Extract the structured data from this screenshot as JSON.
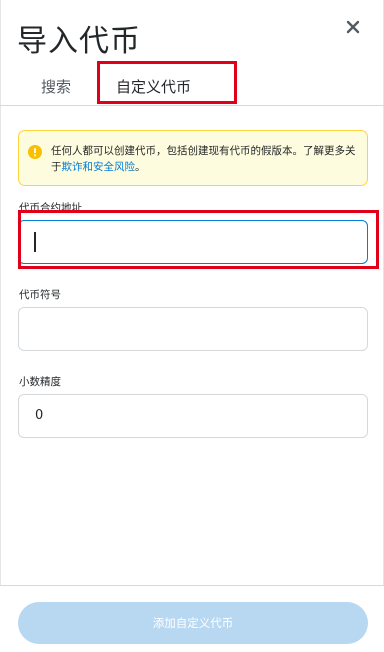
{
  "header": {
    "title": "导入代币"
  },
  "tabs": [
    {
      "label": "搜索"
    },
    {
      "label": "自定义代币"
    }
  ],
  "notice": {
    "text": "任何人都可以创建代币，包括创建现有代币的假版本。了解更多关于",
    "link": "欺诈和安全风险",
    "suffix": "。"
  },
  "fields": {
    "address": {
      "label": "代币合约地址",
      "value": ""
    },
    "symbol": {
      "label": "代币符号",
      "value": ""
    },
    "decimals": {
      "label": "小数精度",
      "value": "0"
    }
  },
  "footer": {
    "button_label": "添加自定义代币"
  },
  "colors": {
    "accent": "#037dd6",
    "warning_bg": "#fefcde",
    "warning_border": "#ffd33d",
    "highlight": "#e0001a",
    "disabled_button": "#b8d7f1"
  }
}
